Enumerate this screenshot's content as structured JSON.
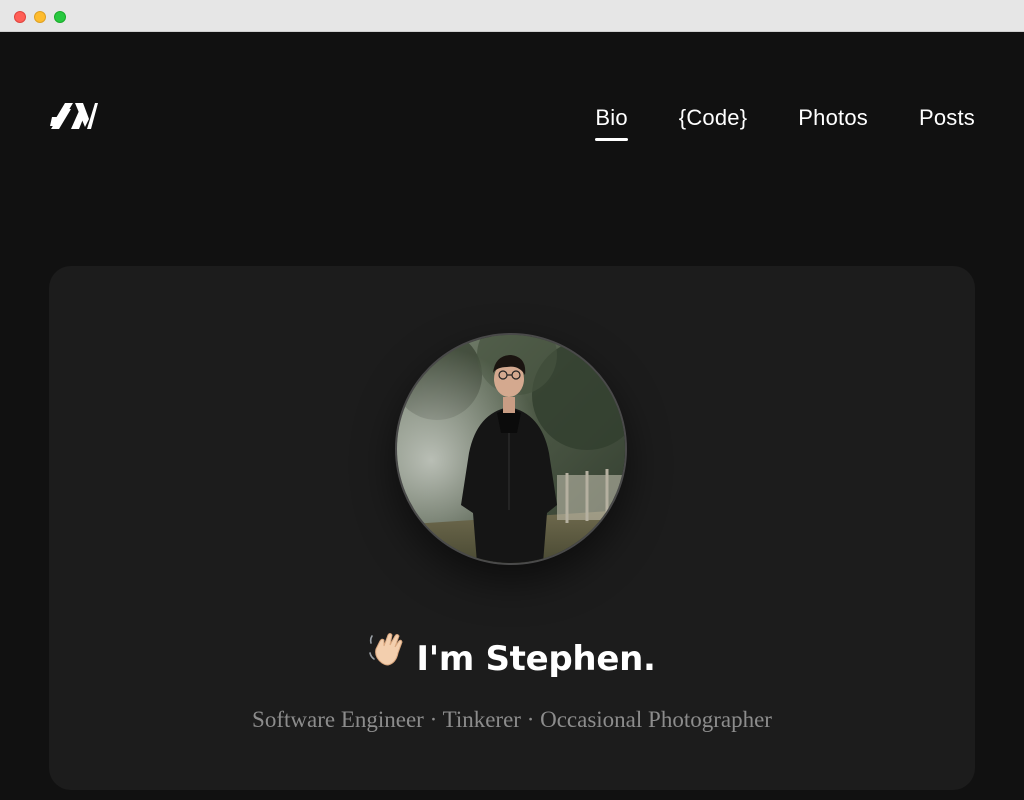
{
  "window": {
    "controls": [
      "close",
      "minimize",
      "maximize"
    ]
  },
  "header": {
    "logo_icon": "sn-monogram-logo",
    "nav": [
      {
        "label": "Bio",
        "active": true
      },
      {
        "label": "{Code}",
        "active": false
      },
      {
        "label": "Photos",
        "active": false
      },
      {
        "label": "Posts",
        "active": false
      }
    ]
  },
  "hero": {
    "avatar_icon": "profile-photo",
    "wave_icon": "waving-hand-emoji",
    "greeting": "I'm Stephen.",
    "tagline": "Software Engineer · Tinkerer · Occasional Photographer"
  },
  "colors": {
    "page_background": "#111111",
    "card_background": "#1c1c1c",
    "text_primary": "#ffffff",
    "text_secondary": "#8c8c8c"
  }
}
